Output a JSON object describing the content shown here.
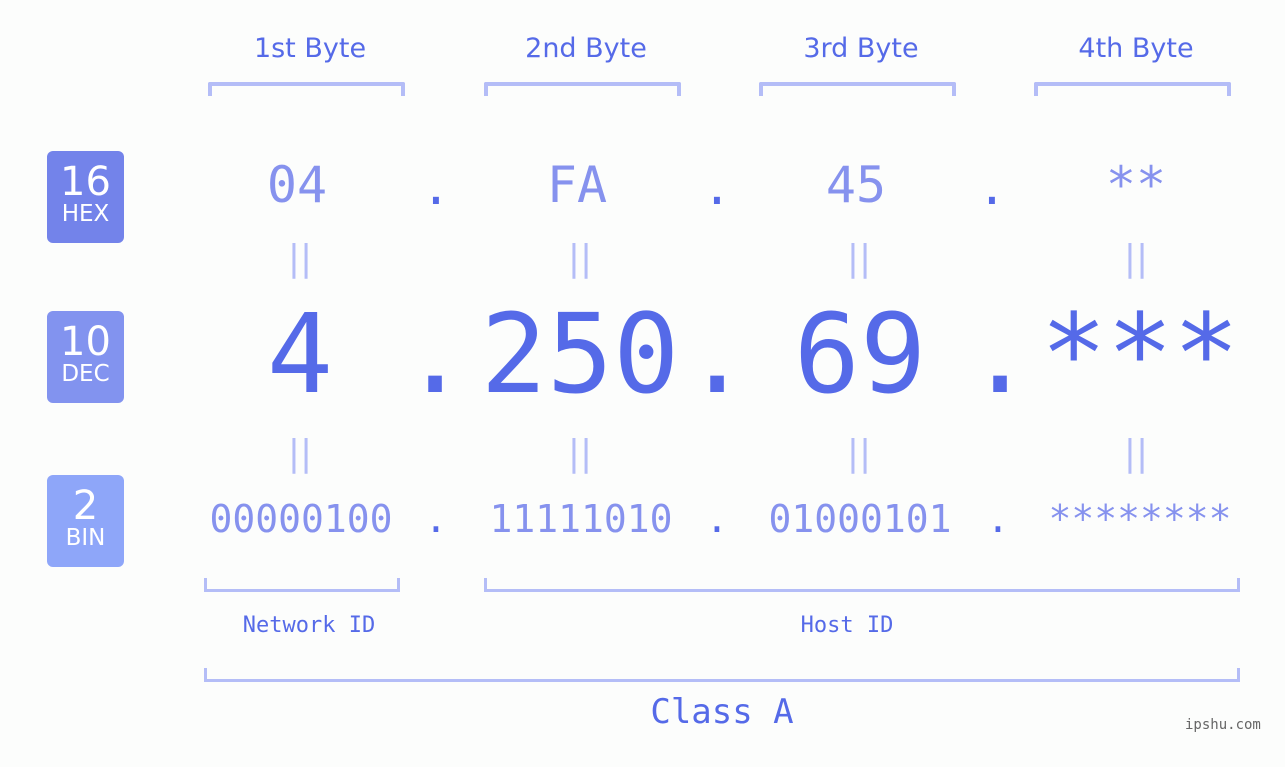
{
  "bytes": [
    {
      "label": "1st Byte",
      "hex": "04",
      "dec": "4",
      "bin": "00000100"
    },
    {
      "label": "2nd Byte",
      "hex": "FA",
      "dec": "250",
      "bin": "11111010"
    },
    {
      "label": "3rd Byte",
      "hex": "45",
      "dec": "69",
      "bin": "01000101"
    },
    {
      "label": "4th Byte",
      "hex": "**",
      "dec": "***",
      "bin": "********"
    }
  ],
  "separator": ".",
  "equals": "||",
  "bases": {
    "hex": {
      "num": "16",
      "label": "HEX",
      "color": "#7383ea"
    },
    "dec": {
      "num": "10",
      "label": "DEC",
      "color": "#8293ef"
    },
    "bin": {
      "num": "2",
      "label": "BIN",
      "color": "#8ea6f9"
    }
  },
  "network_id_label": "Network ID",
  "host_id_label": "Host ID",
  "class_label": "Class A",
  "credit": "ipshu.com",
  "colors": {
    "accent": "#556ae8",
    "light": "#8692ee",
    "bracket": "#b4bdf7"
  }
}
